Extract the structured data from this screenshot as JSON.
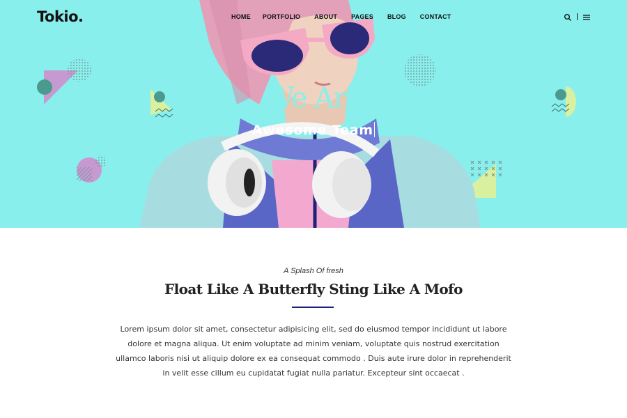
{
  "brand": {
    "logo": "Tokio."
  },
  "nav": {
    "items": [
      {
        "label": "HOME"
      },
      {
        "label": "PORTFOLIO"
      },
      {
        "label": "ABOUT"
      },
      {
        "label": "PAGES"
      },
      {
        "label": "BLOG"
      },
      {
        "label": "CONTACT"
      }
    ]
  },
  "header_tools": {
    "search_icon": "search-icon",
    "menu_icon": "hamburger-menu-icon"
  },
  "hero": {
    "title": "We Are",
    "subtitle": "Awesome Team",
    "background_color": "#88efec"
  },
  "section": {
    "eyebrow": "A Splash Of fresh",
    "headline": "Float Like A Butterfly Sting Like A Mofo",
    "accent_color": "#1f2277",
    "paragraph": "Lorem ipsum dolor sit amet, consectetur adipisicing elit, sed do eiusmod tempor incididunt ut labore dolore et magna aliqua. Ut enim voluptate ad minim veniam, voluptate quis nostrud exercitation ullamco laboris nisi ut aliquip dolore ex ea consequat commodo . Duis aute irure dolor in reprehenderit in velit esse cillum eu cupidatat fugiat nulla pariatur. Excepteur sint occaecat ."
  }
}
